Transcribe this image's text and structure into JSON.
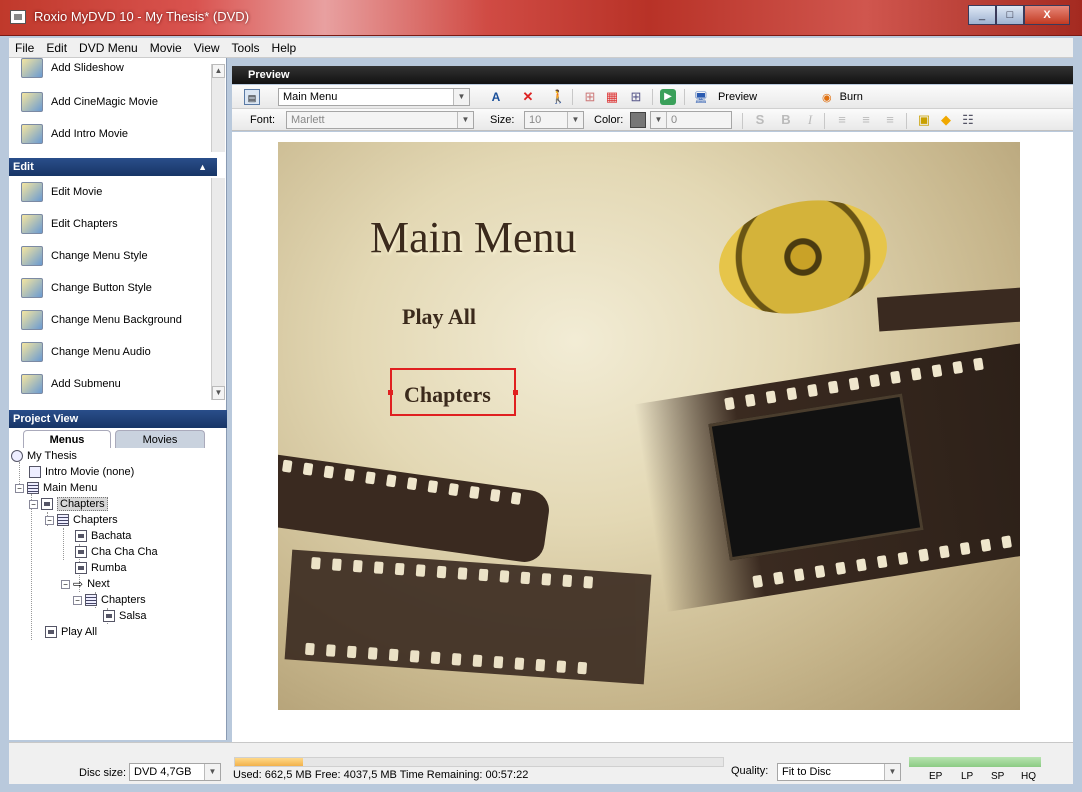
{
  "window": {
    "title": "Roxio MyDVD 10 - My Thesis* (DVD)"
  },
  "window_buttons": {
    "minimize": "_",
    "maximize": "□",
    "close": "X"
  },
  "menubar": [
    "File",
    "Edit",
    "DVD Menu",
    "Movie",
    "View",
    "Tools",
    "Help"
  ],
  "add_tasks": [
    "Add Slideshow",
    "Add CineMagic Movie",
    "Add Intro Movie"
  ],
  "edit_panel": {
    "header": "Edit",
    "items": [
      "Edit Movie",
      "Edit Chapters",
      "Change Menu Style",
      "Change Button Style",
      "Change Menu Background",
      "Change Menu Audio",
      "Add Submenu"
    ]
  },
  "project_view": {
    "header": "Project View",
    "tabs": [
      "Menus",
      "Movies"
    ],
    "active_tab": "Menus",
    "tree": {
      "root": "My Thesis",
      "intro": "Intro Movie (none)",
      "main_menu": "Main Menu",
      "chapters_btn": "Chapters",
      "chapters_menu": "Chapters",
      "items": [
        "Bachata",
        "Cha Cha Cha",
        "Rumba"
      ],
      "next": "Next",
      "sub_chapters": "Chapters",
      "sub_item": "Salsa",
      "play_all": "Play All"
    }
  },
  "preview": {
    "header": "Preview",
    "menu_select": "Main Menu",
    "preview_label": "Preview",
    "burn_label": "Burn",
    "font_label": "Font:",
    "font_value": "Marlett",
    "size_label": "Size:",
    "size_value": "10",
    "color_label": "Color:",
    "color_value": "0",
    "format_glyphs": [
      "S",
      "B",
      "I"
    ]
  },
  "menu_canvas": {
    "title": "Main Menu",
    "buttons": [
      "Play All",
      "Chapters"
    ],
    "selected_button": "Chapters"
  },
  "status": {
    "disc_label": "Disc size:",
    "disc_value": "DVD 4,7GB",
    "usage": "Used: 662,5 MB  Free: 4037,5 MB  Time Remaining: 00:57:22",
    "used_fraction": 0.14,
    "quality_label": "Quality:",
    "quality_value": "Fit to Disc",
    "quality_modes": [
      "EP",
      "LP",
      "SP",
      "HQ"
    ]
  }
}
